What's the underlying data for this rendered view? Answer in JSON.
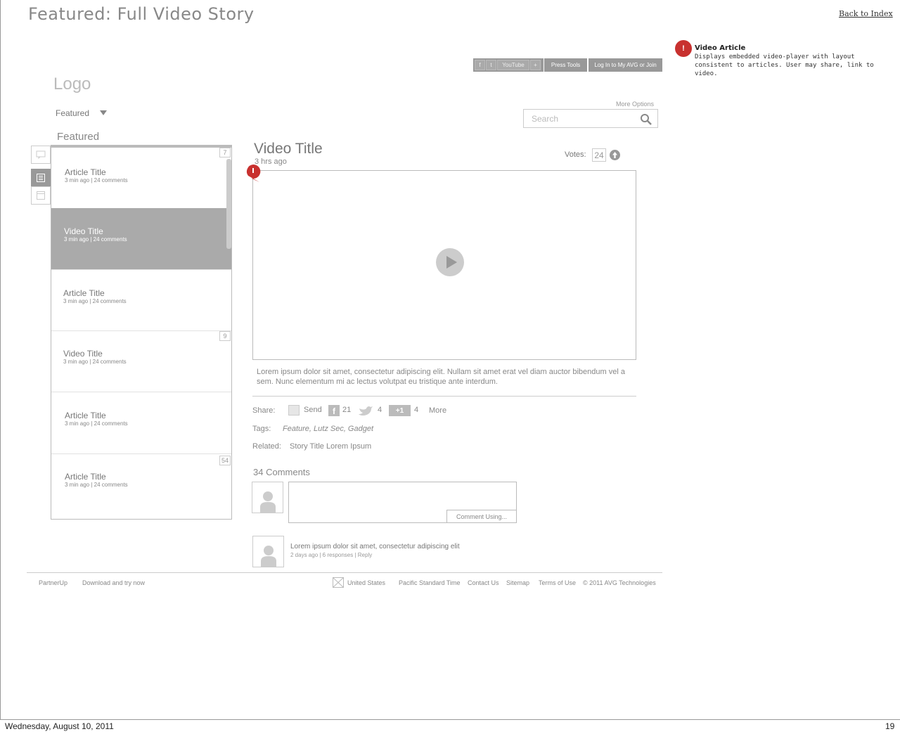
{
  "page": {
    "title": "Featured: Full Video Story",
    "back_link": "Back to Index",
    "date": "Wednesday, August 10, 2011",
    "page_number": "19"
  },
  "annotation": {
    "marker": "!",
    "title": "Video Article",
    "text": "Displays embedded video-player with layout consistent to articles. User may share, link to video."
  },
  "topbar": {
    "social": [
      "f",
      "t",
      "YouTube",
      "+"
    ],
    "press_tools": "Press Tools",
    "login": "Log In to My AVG or Join"
  },
  "header": {
    "logo": "Logo",
    "dropdown_value": "Featured",
    "more_options": "More Options",
    "search_placeholder": "Search"
  },
  "sidebar": {
    "heading": "Featured",
    "items": [
      {
        "title": "Article Title",
        "meta": "3 min ago | 24 comments",
        "badge": "7",
        "selected": false
      },
      {
        "title": "Video Title",
        "meta": "3 min ago | 24 comments",
        "badge": "",
        "selected": true
      },
      {
        "title": "Article Title",
        "meta": "3 min ago | 24 comments",
        "badge": "",
        "selected": false
      },
      {
        "title": "Video Title",
        "meta": "3 min ago | 24 comments",
        "badge": "9",
        "selected": false
      },
      {
        "title": "Article Title",
        "meta": "3 min ago | 24 comments",
        "badge": "",
        "selected": false
      },
      {
        "title": "Article Title",
        "meta": "3 min ago | 24 comments",
        "badge": "54",
        "selected": false
      }
    ]
  },
  "main": {
    "video_title": "Video Title",
    "posted": "3 hrs ago",
    "votes_label": "Votes:",
    "votes_count": "24",
    "description": "Lorem ipsum dolor sit amet, consectetur adipiscing elit. Nullam sit amet erat vel diam auctor bibendum vel a sem. Nunc elementum mi ac lectus volutpat eu tristique ante interdum.",
    "share_label": "Share:",
    "send_label": "Send",
    "facebook_count": "21",
    "twitter_count": "4",
    "plusone_label": "+1",
    "plusone_count": "4",
    "more_label": "More",
    "tags_label": "Tags:",
    "tags": "Feature, Lutz Sec, Gadget",
    "related_label": "Related:",
    "related": "Story Title Lorem Ipsum"
  },
  "comments": {
    "heading": "34 Comments",
    "button": "Comment Using...",
    "first_text": "Lorem ipsum dolor sit amet, consectetur adipiscing elit",
    "first_meta": "2 days ago | 6 responses |",
    "reply": "Reply"
  },
  "footer": {
    "partner": "PartnerUp",
    "download": "Download and try now",
    "country": "United States",
    "timezone": "Pacific Standard Time",
    "contact": "Contact Us",
    "sitemap": "Sitemap",
    "terms": "Terms of Use",
    "copyright": "© 2011 AVG Technologies"
  }
}
